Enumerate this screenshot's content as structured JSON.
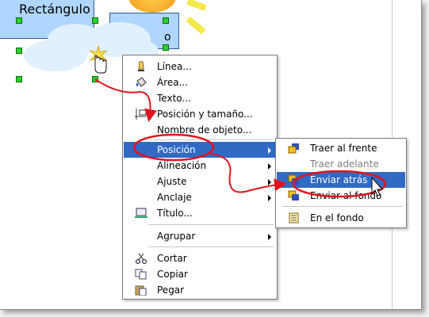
{
  "canvas": {
    "title": "Rectángulo",
    "extra_label": "o"
  },
  "context_menu": {
    "items": [
      {
        "id": "linea",
        "label": "Línea...",
        "icon": "line-pen-icon"
      },
      {
        "id": "area",
        "label": "Área...",
        "icon": "paint-bucket-icon"
      },
      {
        "id": "texto",
        "label": "Texto..."
      },
      {
        "id": "posicion-tamano",
        "label": "Posición y tamaño...",
        "icon": "position-size-icon"
      },
      {
        "id": "nombre-objeto",
        "label": "Nombre de objeto..."
      },
      {
        "id": "posicion",
        "label": "Posición",
        "submenu": true,
        "highlighted": true
      },
      {
        "id": "alineacion",
        "label": "Alineación",
        "submenu": true
      },
      {
        "id": "ajuste",
        "label": "Ajuste",
        "submenu": true
      },
      {
        "id": "anclaje",
        "label": "Anclaje",
        "submenu": true
      },
      {
        "id": "titulo",
        "label": "Título...",
        "icon": "title-frame-icon"
      },
      {
        "id": "agrupar",
        "label": "Agrupar",
        "submenu": true
      },
      {
        "id": "cortar",
        "label": "Cortar",
        "icon": "scissors-icon"
      },
      {
        "id": "copiar",
        "label": "Copiar",
        "icon": "copy-icon"
      },
      {
        "id": "pegar",
        "label": "Pegar",
        "icon": "paste-icon"
      }
    ]
  },
  "submenu": {
    "items": [
      {
        "id": "traer-frente",
        "label": "Traer al frente",
        "icon": "bring-to-front-icon"
      },
      {
        "id": "traer-adelante",
        "label": "Traer adelante",
        "disabled": true
      },
      {
        "id": "enviar-atras",
        "label": "Enviar atrás",
        "icon": "send-backward-icon",
        "highlighted": true
      },
      {
        "id": "enviar-fondo",
        "label": "Enviar al fondo",
        "icon": "send-to-back-icon"
      },
      {
        "id": "en-el-fondo",
        "label": "En el fondo",
        "icon": "to-background-icon"
      }
    ]
  },
  "colors": {
    "highlight": "#316ac5",
    "annotation": "#e0141e",
    "handle": "#2bd12b",
    "shape_fill": "#aed6ff"
  }
}
